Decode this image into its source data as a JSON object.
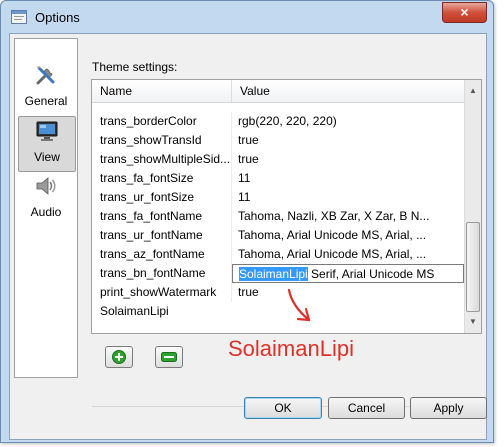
{
  "window": {
    "title": "Options",
    "close_icon": "×"
  },
  "sidebar": {
    "items": [
      {
        "label": "General",
        "icon": "tools-icon"
      },
      {
        "label": "View",
        "icon": "monitor-icon",
        "selected": true
      },
      {
        "label": "Audio",
        "icon": "speaker-icon"
      }
    ]
  },
  "theme": {
    "label": "Theme settings:",
    "columns": {
      "name": "Name",
      "value": "Value"
    },
    "rows": [
      {
        "name": "trans_borderColor",
        "value": "rgb(220, 220, 220)"
      },
      {
        "name": "trans_showTransId",
        "value": "true"
      },
      {
        "name": "trans_showMultipleSid...",
        "value": "true"
      },
      {
        "name": "trans_fa_fontSize",
        "value": "11"
      },
      {
        "name": "trans_ur_fontSize",
        "value": "11"
      },
      {
        "name": "trans_fa_fontName",
        "value": "Tahoma, Nazli, XB Zar, X Zar, B N..."
      },
      {
        "name": "trans_ur_fontName",
        "value": "Tahoma, Arial Unicode MS, Arial, ..."
      },
      {
        "name": "trans_az_fontName",
        "value": "Tahoma, Arial Unicode MS, Arial, ..."
      },
      {
        "name": "trans_bn_fontName",
        "value_selected": "SolaimanLipi",
        "value_rest": " Serif, Arial Unicode MS"
      },
      {
        "name": "print_showWatermark",
        "value": "true"
      },
      {
        "name": "SolaimanLipi",
        "value": ""
      }
    ]
  },
  "annotation": {
    "text": "SolaimanLipi",
    "color": "#e0302a"
  },
  "buttons": {
    "ok": "OK",
    "cancel": "Cancel",
    "apply": "Apply"
  },
  "colors": {
    "selection": "#3399ff",
    "add": "#2fa12f",
    "remove": "#2fa12f"
  }
}
